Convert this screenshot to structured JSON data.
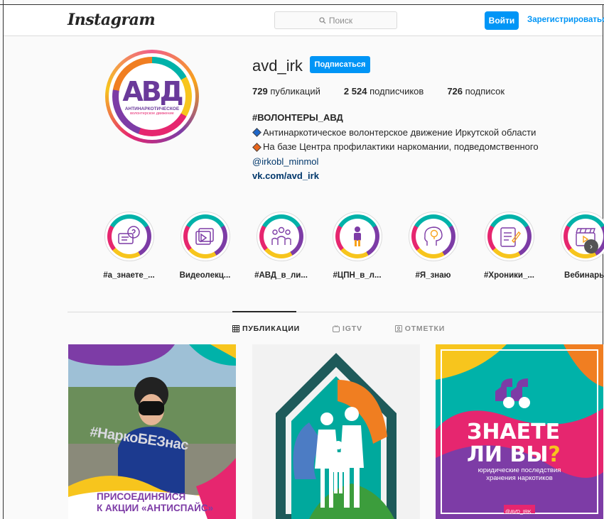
{
  "header": {
    "logo": "Instagram",
    "search_placeholder": "Поиск",
    "login_label": "Войти",
    "register_label": "Зарегистрироваться"
  },
  "profile": {
    "avatar_abbr": "АВД",
    "avatar_line1": "АНТИНАРКОТИЧЕСКОЕ",
    "avatar_line2": "волонтерское движение",
    "username": "avd_irk",
    "follow_label": "Подписаться",
    "stats": {
      "posts_count": "729",
      "posts_label": "публикаций",
      "followers_count": "2 524",
      "followers_label": "подписчиков",
      "following_count": "726",
      "following_label": "подписок"
    },
    "bio": {
      "name": "#ВОЛОНТЕРЫ_АВД",
      "line1": "Антинаркотическое волонтерское движение Иркутской области",
      "line2": "На базе Центра профилактики наркомании, подведомственного",
      "mention": "@irkobl_minmol",
      "link": "vk.com/avd_irk"
    }
  },
  "highlights": [
    {
      "label": "#а_знаете_...",
      "icon": "chat-question-icon"
    },
    {
      "label": "Видеолекц...",
      "icon": "video-play-icon"
    },
    {
      "label": "#АВД_в_ли...",
      "icon": "group-people-icon"
    },
    {
      "label": "#ЦПН_в_л...",
      "icon": "person-icon"
    },
    {
      "label": "#Я_знаю",
      "icon": "head-lightbulb-icon"
    },
    {
      "label": "#Хроники_...",
      "icon": "document-pen-icon"
    },
    {
      "label": "Вебинары",
      "icon": "clapperboard-icon"
    }
  ],
  "tabs": [
    {
      "label": "ПУБЛИКАЦИИ",
      "icon": "grid-icon",
      "active": true
    },
    {
      "label": "IGTV",
      "icon": "tv-icon",
      "active": false
    },
    {
      "label": "ОТМЕТКИ",
      "icon": "tag-person-icon",
      "active": false
    }
  ],
  "posts": {
    "post1_hashtag": "#НаркоБЕЗнас",
    "post1_line1": "ПРИСОЕДИНЯЙСЯ",
    "post1_line2": "К АКЦИИ «АНТИСПАЙС»",
    "post3_line1": "ЗНАЕТЕ",
    "post3_line2": "ЛИ ВЫ",
    "post3_mark": "?",
    "post3_sub": "юридические последствия хранения наркотиков",
    "post3_handle": "@AVD_IRK"
  },
  "colors": {
    "accent": "#0095f6",
    "brand_purple": "#7d3ca6",
    "brand_teal": "#00b2a9",
    "brand_yellow": "#f7c51d",
    "brand_pink": "#e6266f",
    "brand_orange": "#f07e21"
  }
}
